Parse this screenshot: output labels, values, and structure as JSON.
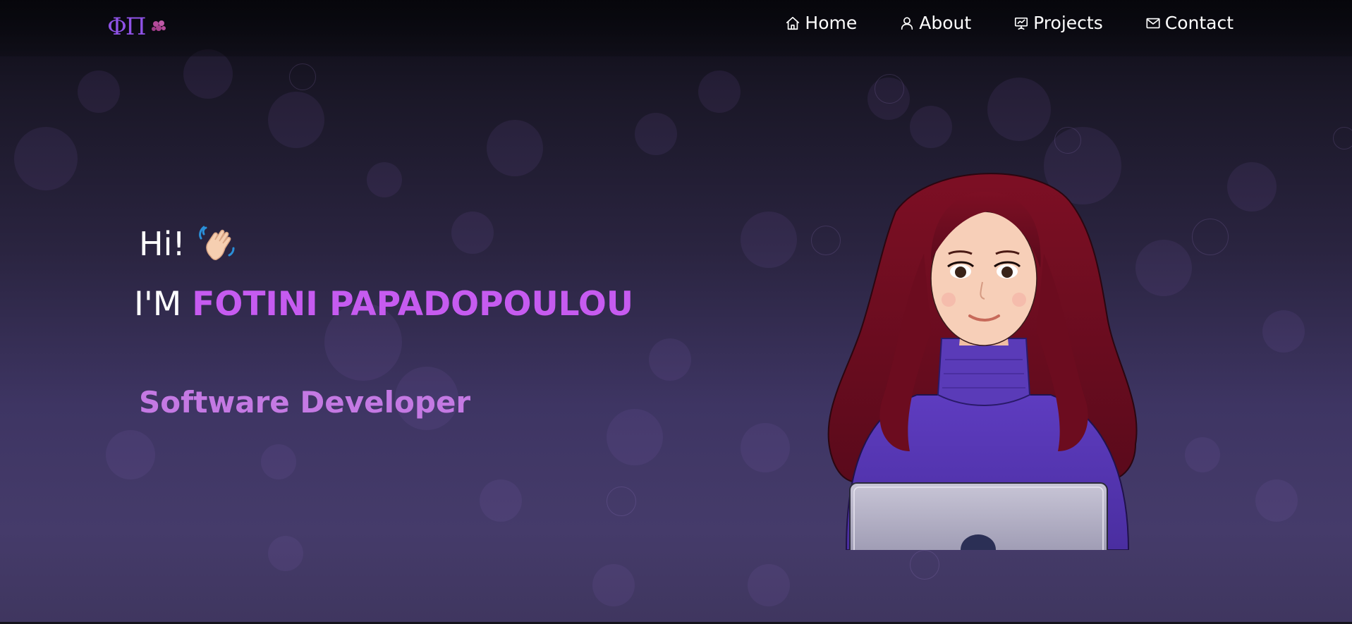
{
  "brand": {
    "logo_text": "ΦΠ"
  },
  "nav": {
    "items": [
      {
        "label": "Home",
        "icon": "home-icon"
      },
      {
        "label": "About",
        "icon": "user-icon"
      },
      {
        "label": "Projects",
        "icon": "presentation-icon"
      },
      {
        "label": "Contact",
        "icon": "mail-icon"
      }
    ]
  },
  "hero": {
    "greeting": "Hi!",
    "intro_prefix": "I'M",
    "name": "FOTINI PAPADOPOULOU",
    "role": "Software Developer"
  },
  "colors": {
    "accent": "#c65bf0",
    "role": "#c479e3",
    "logo": "#8f52e6"
  }
}
